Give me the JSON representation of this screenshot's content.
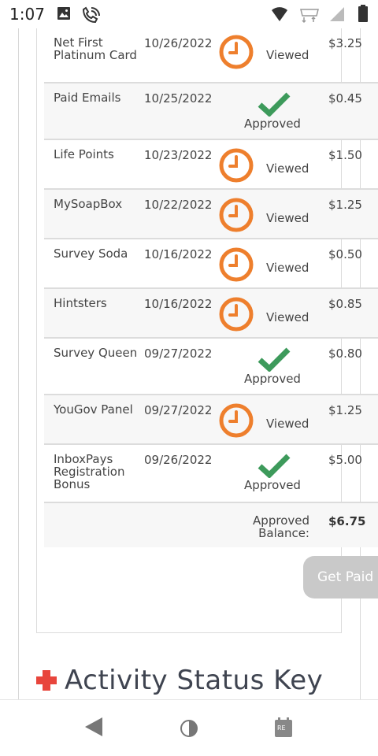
{
  "status_bar": {
    "time": "1:07",
    "icons": [
      "photo-icon",
      "wifi-calling-icon",
      "wifi-icon",
      "data-icon",
      "signal-icon",
      "battery-icon"
    ]
  },
  "colors": {
    "clock_orange": "#ee7f2d",
    "check_green": "#3d9a5b",
    "plus_red": "#e8453c",
    "button_gray": "#c9c9c9"
  },
  "rows": [
    {
      "name": "Net First Platinum Card",
      "date": "10/26/2022",
      "status": "Viewed",
      "icon": "clock-icon",
      "amount": "$3.25"
    },
    {
      "name": "Paid Emails",
      "date": "10/25/2022",
      "status": "Approved",
      "icon": "check-icon",
      "amount": "$0.45"
    },
    {
      "name": "Life Points",
      "date": "10/23/2022",
      "status": "Viewed",
      "icon": "clock-icon",
      "amount": "$1.50"
    },
    {
      "name": "MySoapBox",
      "date": "10/22/2022",
      "status": "Viewed",
      "icon": "clock-icon",
      "amount": "$1.25"
    },
    {
      "name": "Survey Soda",
      "date": "10/16/2022",
      "status": "Viewed",
      "icon": "clock-icon",
      "amount": "$0.50"
    },
    {
      "name": "Hintsters",
      "date": "10/16/2022",
      "status": "Viewed",
      "icon": "clock-icon",
      "amount": "$0.85"
    },
    {
      "name": "Survey Queen",
      "date": "09/27/2022",
      "status": "Approved",
      "icon": "check-icon",
      "amount": "$0.80"
    },
    {
      "name": "YouGov Panel",
      "date": "09/27/2022",
      "status": "Viewed",
      "icon": "clock-icon",
      "amount": "$1.25"
    },
    {
      "name": "InboxPays Registration Bonus",
      "date": "09/26/2022",
      "status": "Approved",
      "icon": "check-icon",
      "amount": "$5.00"
    }
  ],
  "summary": {
    "label_line1": "Approved",
    "label_line2": "Balance:",
    "value": "$6.75"
  },
  "get_paid_button": "Get Paid",
  "activity_key": {
    "title": "Activity Status Key"
  },
  "nav": [
    "back-icon",
    "home-icon",
    "recents-icon"
  ]
}
